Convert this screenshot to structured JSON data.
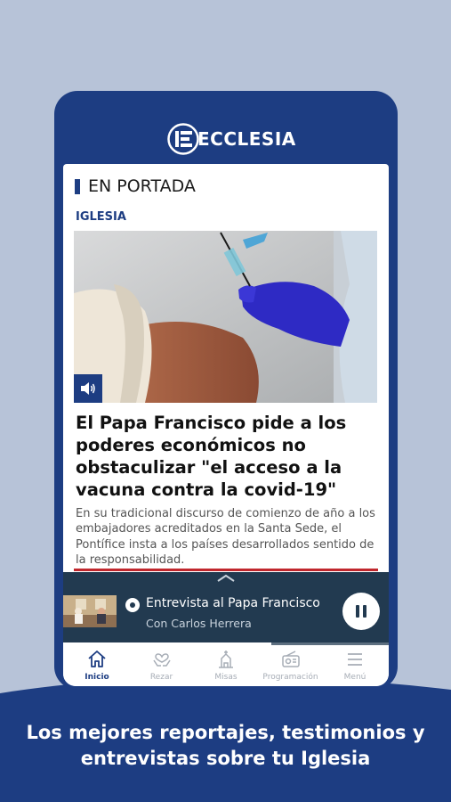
{
  "app": {
    "logo_text": "ECCLESIA"
  },
  "section": {
    "title": "EN PORTADA"
  },
  "article": {
    "category": "IGLESIA",
    "headline": "El Papa Francisco pide a los poderes económicos no obstaculizar \"el acceso a la vacuna contra la covid-19\"",
    "summary": "En su tradicional discurso de comienzo de año a los embajadores acreditados en la Santa Sede, el Pontífice insta a los países desarrollados sentido de la responsabilidad.",
    "image_icon": "speaker-icon"
  },
  "player": {
    "title": "Entrevista al Papa Francisco",
    "subtitle": "Con Carlos Herrera",
    "state": "playing",
    "progress": 0.64
  },
  "tabs": [
    {
      "label": "Inicio",
      "icon": "home-icon",
      "active": true
    },
    {
      "label": "Rezar",
      "icon": "pray-hands-icon",
      "active": false
    },
    {
      "label": "Misas",
      "icon": "church-icon",
      "active": false
    },
    {
      "label": "Programación",
      "icon": "radio-icon",
      "active": false
    },
    {
      "label": "Menú",
      "icon": "menu-icon",
      "active": false
    }
  ],
  "caption": {
    "line1": "Los mejores reportajes, testimonios y",
    "line2": "entrevistas sobre tu Iglesia"
  },
  "colors": {
    "background": "#b7c3d8",
    "brand": "#1d3d82",
    "player": "#223a50",
    "accent_red": "#c0272d"
  }
}
